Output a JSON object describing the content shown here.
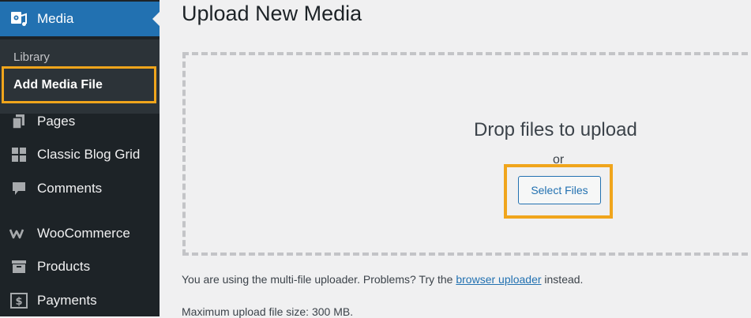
{
  "sidebar": {
    "current": {
      "label": "Media",
      "icon": "media-icon"
    },
    "submenu": {
      "library": "Library",
      "add_new": "Add Media File"
    },
    "items": [
      {
        "label": "Pages",
        "icon": "pages-icon"
      },
      {
        "label": "Classic Blog Grid",
        "icon": "grid-icon"
      },
      {
        "label": "Comments",
        "icon": "comments-icon"
      },
      {
        "label": "WooCommerce",
        "icon": "woocommerce-icon"
      },
      {
        "label": "Products",
        "icon": "products-icon"
      },
      {
        "label": "Payments",
        "icon": "payments-icon"
      }
    ]
  },
  "main": {
    "title": "Upload New Media",
    "drop_text": "Drop files to upload",
    "or_text": "or",
    "select_button": "Select Files",
    "uploader_note_prefix": "You are using the multi-file uploader. Problems? Try the ",
    "uploader_link": "browser uploader",
    "uploader_note_suffix": " instead.",
    "max_size": "Maximum upload file size: 300 MB."
  },
  "colors": {
    "sidebar_bg": "#1d2327",
    "accent": "#2271b1",
    "highlight": "#f0a51c"
  }
}
